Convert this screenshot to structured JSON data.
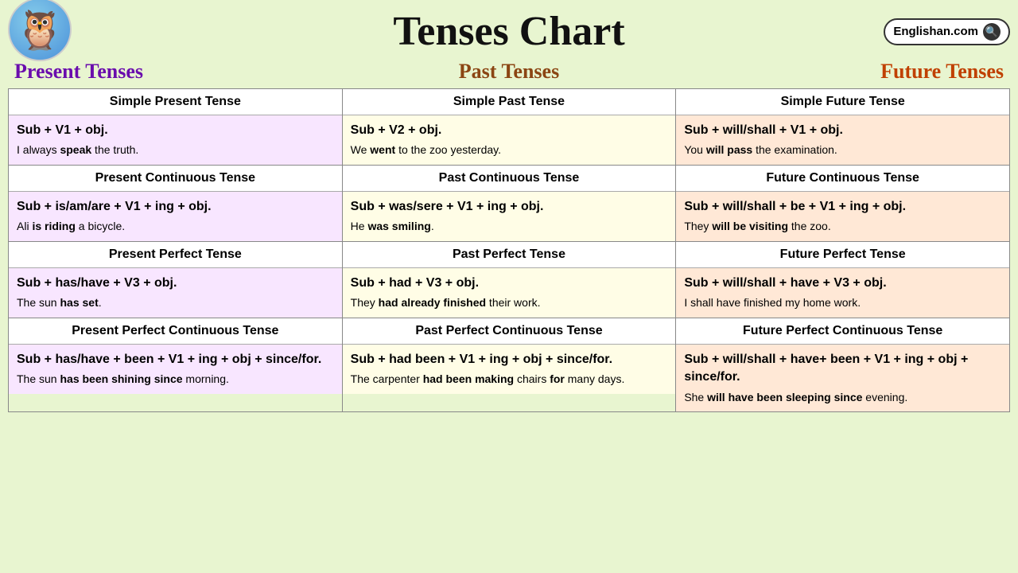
{
  "header": {
    "title": "Tenses Chart",
    "site": "Englishan.com",
    "owl_emoji": "🦉",
    "col_present": "Present Tenses",
    "col_past": "Past Tenses",
    "col_future": "Future Tenses"
  },
  "rows": [
    {
      "headers": [
        "Simple Present Tense",
        "Simple Past Tense",
        "Simple Future Tense"
      ],
      "present_formula": "Sub + V1 + obj.",
      "present_example_plain": "I always ",
      "present_example_bold": "speak",
      "present_example_end": " the truth.",
      "past_formula": "Sub + V2 + obj.",
      "past_example_plain": "We ",
      "past_example_bold": "went",
      "past_example_end": " to the zoo yesterday.",
      "future_formula": "Sub + will/shall + V1 + obj.",
      "future_example_plain": "You ",
      "future_example_bold": "will pass",
      "future_example_end": " the examination."
    },
    {
      "headers": [
        "Present Continuous Tense",
        "Past Continuous Tense",
        "Future Continuous Tense"
      ],
      "present_formula": "Sub + is/am/are + V1 + ing + obj.",
      "present_example_plain": "Ali ",
      "present_example_bold": "is riding",
      "present_example_end": " a bicycle.",
      "past_formula": "Sub + was/sere + V1 + ing + obj.",
      "past_example_plain": "He ",
      "past_example_bold": "was smiling",
      "past_example_end": ".",
      "future_formula": "Sub + will/shall + be + V1 + ing + obj.",
      "future_example_plain": "They ",
      "future_example_bold": "will be visiting",
      "future_example_end": " the zoo."
    },
    {
      "headers": [
        "Present Perfect Tense",
        "Past Perfect Tense",
        "Future Perfect Tense"
      ],
      "present_formula": "Sub + has/have + V3 + obj.",
      "present_example_plain": "The sun ",
      "present_example_bold": "has set",
      "present_example_end": ".",
      "past_formula": "Sub + had + V3 + obj.",
      "past_example_plain": "They ",
      "past_example_bold": "had already finished",
      "past_example_end": " their work.",
      "future_formula": "Sub + will/shall + have + V3 + obj.",
      "future_example_plain": "I shall have finished my home work.",
      "future_example_bold": "",
      "future_example_end": ""
    },
    {
      "headers": [
        "Present Perfect Continuous Tense",
        "Past Perfect Continuous Tense",
        "Future Perfect Continuous Tense"
      ],
      "present_formula": "Sub + has/have + been + V1 + ing + obj + since/for.",
      "present_example_plain": "The sun ",
      "present_example_bold": "has been shining since",
      "present_example_end": " morning.",
      "past_formula": "Sub + had been + V1 + ing + obj + since/for.",
      "past_example_plain": "The carpenter ",
      "past_example_bold": "had been making",
      "past_example_end": " chairs ",
      "past_example_bold2": "for",
      "past_example_end2": " many days.",
      "future_formula": "Sub + will/shall + have+ been + V1 + ing + obj + since/for.",
      "future_example_plain": "She ",
      "future_example_bold": "will have been sleeping since",
      "future_example_end": " evening."
    }
  ]
}
